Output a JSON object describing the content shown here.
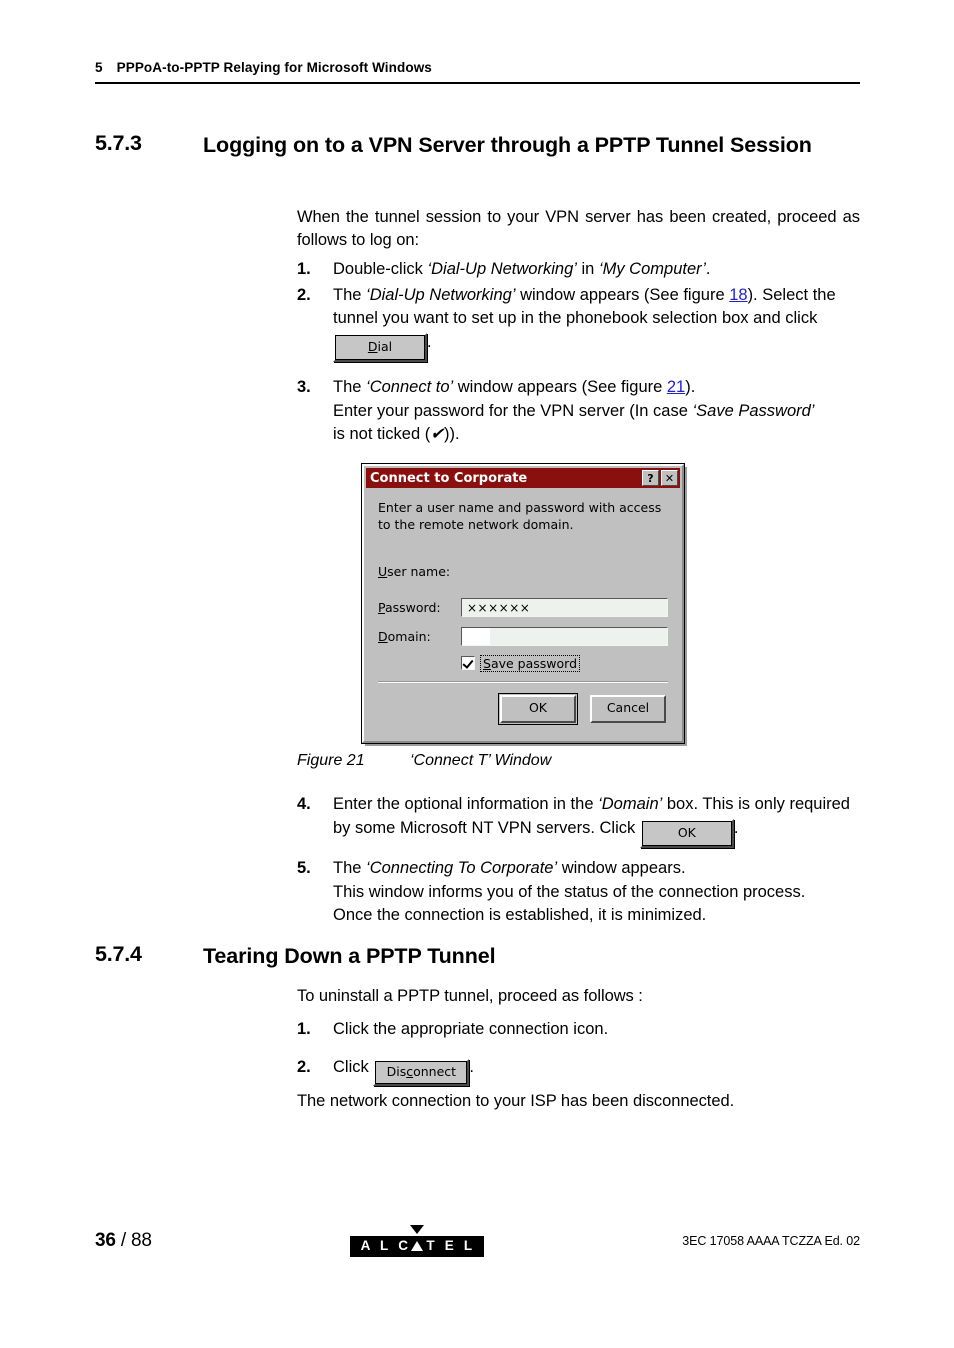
{
  "header": {
    "chapter_number": "5",
    "chapter_title": "PPPoA-to-PPTP Relaying for Microsoft Windows"
  },
  "sections": [
    {
      "number": "5.7.3",
      "title": "Logging on to a VPN Server through a PPTP Tunnel Session"
    },
    {
      "number": "5.7.4",
      "title": "Tearing Down a PPTP Tunnel"
    }
  ],
  "intro_paragraph": "When the tunnel session to your VPN server has been created, proceed as follows to log on:",
  "steps_logon": {
    "n1": "1.",
    "n2": "2.",
    "n3": "3.",
    "n4": "4.",
    "n5": "5.",
    "s1_pre": "Double-click ",
    "s1_em1": "‘Dial-Up Networking’",
    "s1_mid": " in ",
    "s1_em2": "‘My Computer’",
    "s1_post": ".",
    "s2_pre": "The ",
    "s2_em1": "‘Dial-Up Networking’",
    "s2_mid": " window appears (See figure ",
    "s2_xref": "18",
    "s2_post": ").",
    "s2_line2": "Select the tunnel you want to set up in the phonebook selection box and click",
    "s2_line2_tail": ".",
    "s3_pre": "The ",
    "s3_em1": "‘Connect to’",
    "s3_mid": " window appears (See figure ",
    "s3_xref": "21",
    "s3_post": ").",
    "s3_line2_pre": "Enter your password for the VPN server (In case ",
    "s3_line2_em": "‘Save Password’",
    "s3_line3": "is not ticked (",
    "s3_tick": "✔",
    "s3_line3_post": ")).",
    "s4_pre": "Enter the optional information in the ",
    "s4_em": "‘Domain’",
    "s4_mid": " box. This is only required by some Microsoft NT VPN servers. Click",
    "s4_post": ".",
    "s5_pre": "The ",
    "s5_em": "‘Connecting To Corporate’",
    "s5_post": " window appears.",
    "s5_line2": "This window informs you of the status of the connection process.",
    "s5_line3": "Once the connection is established, it is minimized."
  },
  "buttons": {
    "dial_accel": "D",
    "dial_rest": "ial",
    "ok_inline": "OK",
    "disconnect_pre": "Dis",
    "disconnect_accel": "c",
    "disconnect_rest": "onnect"
  },
  "dialog": {
    "title": "Connect to Corporate",
    "help_button": "?",
    "close_button": "✕",
    "instruction": "Enter a user name and password with access to the remote network domain.",
    "fields": [
      {
        "accel": "U",
        "label_rest": "ser name:",
        "value": "",
        "has_input": false
      },
      {
        "accel": "P",
        "label_rest": "assword:",
        "value": "××××××",
        "has_input": true
      },
      {
        "accel": "D",
        "label_rest": "omain:",
        "value": "",
        "has_input": true
      }
    ],
    "save_password_accel": "S",
    "save_password_rest": "ave password",
    "save_password_checked": true,
    "ok_label": "OK",
    "cancel_label": "Cancel",
    "title_bar_color": "#8a0f0f",
    "face_color": "#c0c0c0"
  },
  "figure_caption": {
    "label": "Figure 21",
    "text": "‘Connect T’ Window"
  },
  "teardown": {
    "intro": "To uninstall a PPTP tunnel, proceed as follows :",
    "n1": "1.",
    "n2": "2.",
    "s1": "Click the appropriate connection icon.",
    "s2_pre": "Click",
    "s2_post": ".",
    "closing": "The network connection to your ISP has been disconnected."
  },
  "footer": {
    "page_current": "36",
    "page_sep": " / ",
    "page_total": "88",
    "logo_text": "ALCATEL",
    "logo_letters_pre": "A L C",
    "logo_letters_post": "T E L",
    "doc_id": "3EC 17058 AAAA TCZZA Ed. 02"
  }
}
